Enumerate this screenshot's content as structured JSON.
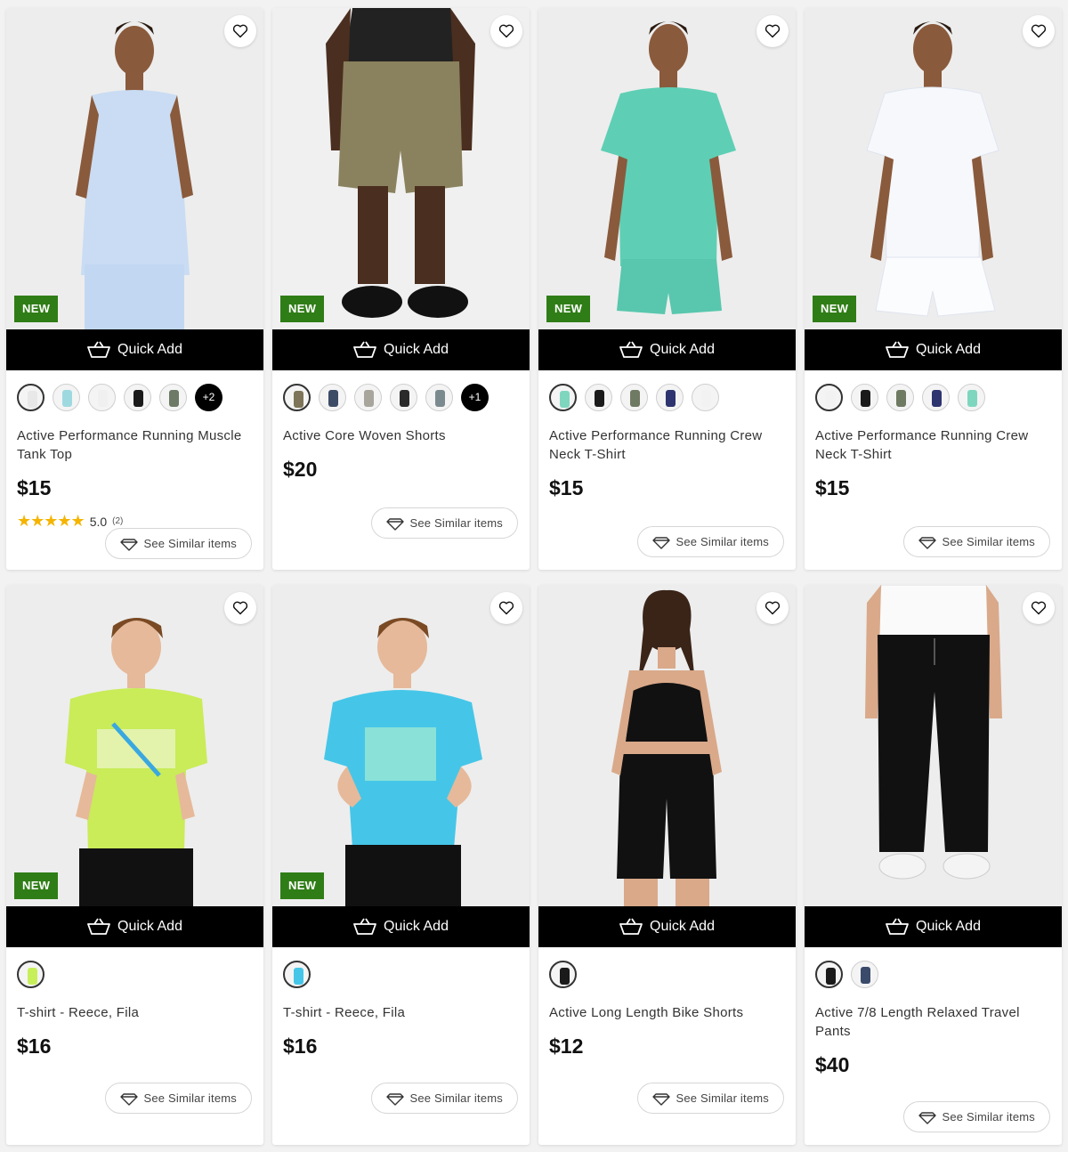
{
  "quick_add_label": "Quick Add",
  "see_similar_label": "See Similar items",
  "new_badge_label": "NEW",
  "products": [
    {
      "name": "Active Performance Running Muscle Tank Top",
      "price": "$15",
      "is_new": true,
      "rating": {
        "score": "5.0",
        "count": "(2)",
        "stars": 5
      },
      "swatches": [
        "#e8e8e8",
        "#9fd9e0",
        "#f0f0f0",
        "#1a1a1a",
        "#6d7a66"
      ],
      "more_swatches": "+2"
    },
    {
      "name": "Active Core Woven Shorts",
      "price": "$20",
      "is_new": true,
      "swatches": [
        "#7d7459",
        "#3d4c66",
        "#a8a59d",
        "#2a2a2a",
        "#7b8a8e"
      ],
      "more_swatches": "+1"
    },
    {
      "name": "Active Performance Running Crew Neck T-Shirt",
      "price": "$15",
      "is_new": true,
      "swatches": [
        "#7fd6bf",
        "#1a1a1a",
        "#6f7a62",
        "#2d3470",
        "#f2f2f2"
      ]
    },
    {
      "name": "Active Performance Running Crew Neck T-Shirt",
      "price": "$15",
      "is_new": true,
      "swatches": [
        "#f2f2f2",
        "#1a1a1a",
        "#6f7a62",
        "#2d3470",
        "#7fd6bf"
      ]
    },
    {
      "name": "T-shirt - Reece, Fila",
      "price": "$16",
      "is_new": true,
      "swatches": [
        "#c7ef5a"
      ]
    },
    {
      "name": "T-shirt - Reece, Fila",
      "price": "$16",
      "is_new": true,
      "swatches": [
        "#45c6e8"
      ]
    },
    {
      "name": "Active Long Length Bike Shorts",
      "price": "$12",
      "is_new": false,
      "swatches": [
        "#1a1a1a"
      ]
    },
    {
      "name": "Active 7/8 Length Relaxed Travel Pants",
      "price": "$40",
      "is_new": false,
      "swatches": [
        "#1a1a1a",
        "#3a4a6a"
      ]
    }
  ]
}
